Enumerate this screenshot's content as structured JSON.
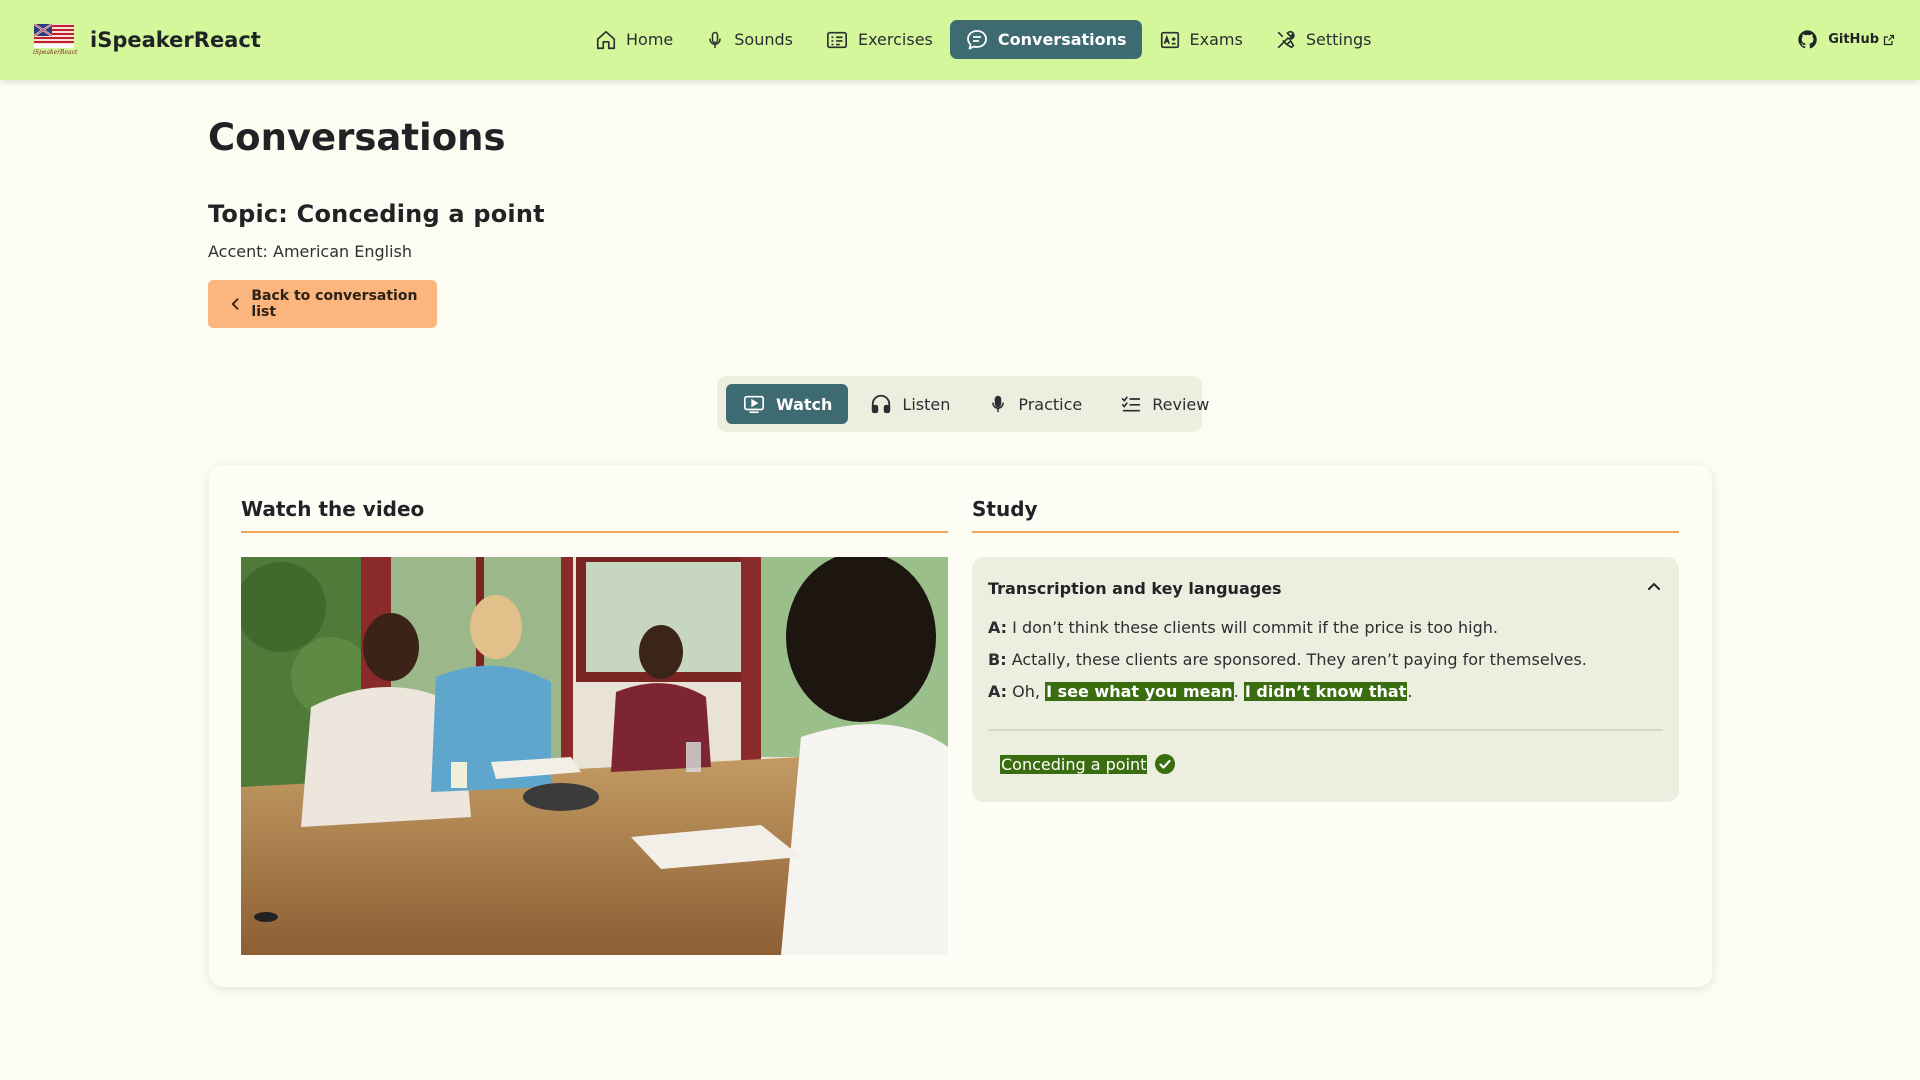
{
  "app": {
    "name": "iSpeakerReact",
    "logo_caption": "iSpeakerReact"
  },
  "nav": {
    "items": [
      {
        "label": "Home",
        "icon": "home-icon"
      },
      {
        "label": "Sounds",
        "icon": "microphone-icon"
      },
      {
        "label": "Exercises",
        "icon": "exercises-icon"
      },
      {
        "label": "Conversations",
        "icon": "chat-bubble-icon",
        "active": true
      },
      {
        "label": "Exams",
        "icon": "exam-icon"
      },
      {
        "label": "Settings",
        "icon": "tools-icon"
      }
    ],
    "github_label": "GitHub"
  },
  "page": {
    "title": "Conversations",
    "topic": "Topic: Conceding a point",
    "accent": "Accent: American English",
    "back_button": "Back to conversation list"
  },
  "mode_tabs": [
    {
      "label": "Watch",
      "icon": "play-screen-icon",
      "active": true
    },
    {
      "label": "Listen",
      "icon": "headphones-icon"
    },
    {
      "label": "Practice",
      "icon": "microphone-icon"
    },
    {
      "label": "Review",
      "icon": "checklist-icon"
    }
  ],
  "watch": {
    "title": "Watch the video"
  },
  "study": {
    "title": "Study",
    "panel_title": "Transcription and key languages",
    "lines": [
      {
        "speaker": "A:",
        "text": "I don’t think these clients will commit if the price is too high."
      },
      {
        "speaker": "B:",
        "text": "Actally, these clients are sponsored. They aren’t paying for themselves."
      },
      {
        "speaker": "A:",
        "pre": "Oh,",
        "hl1": "I see what you mean",
        "mid": ".",
        "hl2": "I didn’t know that",
        "post": "."
      }
    ],
    "key_phrase": "Conceding a point"
  },
  "colors": {
    "navbar": "#d4f79c",
    "active": "#3e6b71",
    "back_button": "#fcb57d",
    "highlight": "#3a6d10",
    "rule": "#f0a35b"
  }
}
